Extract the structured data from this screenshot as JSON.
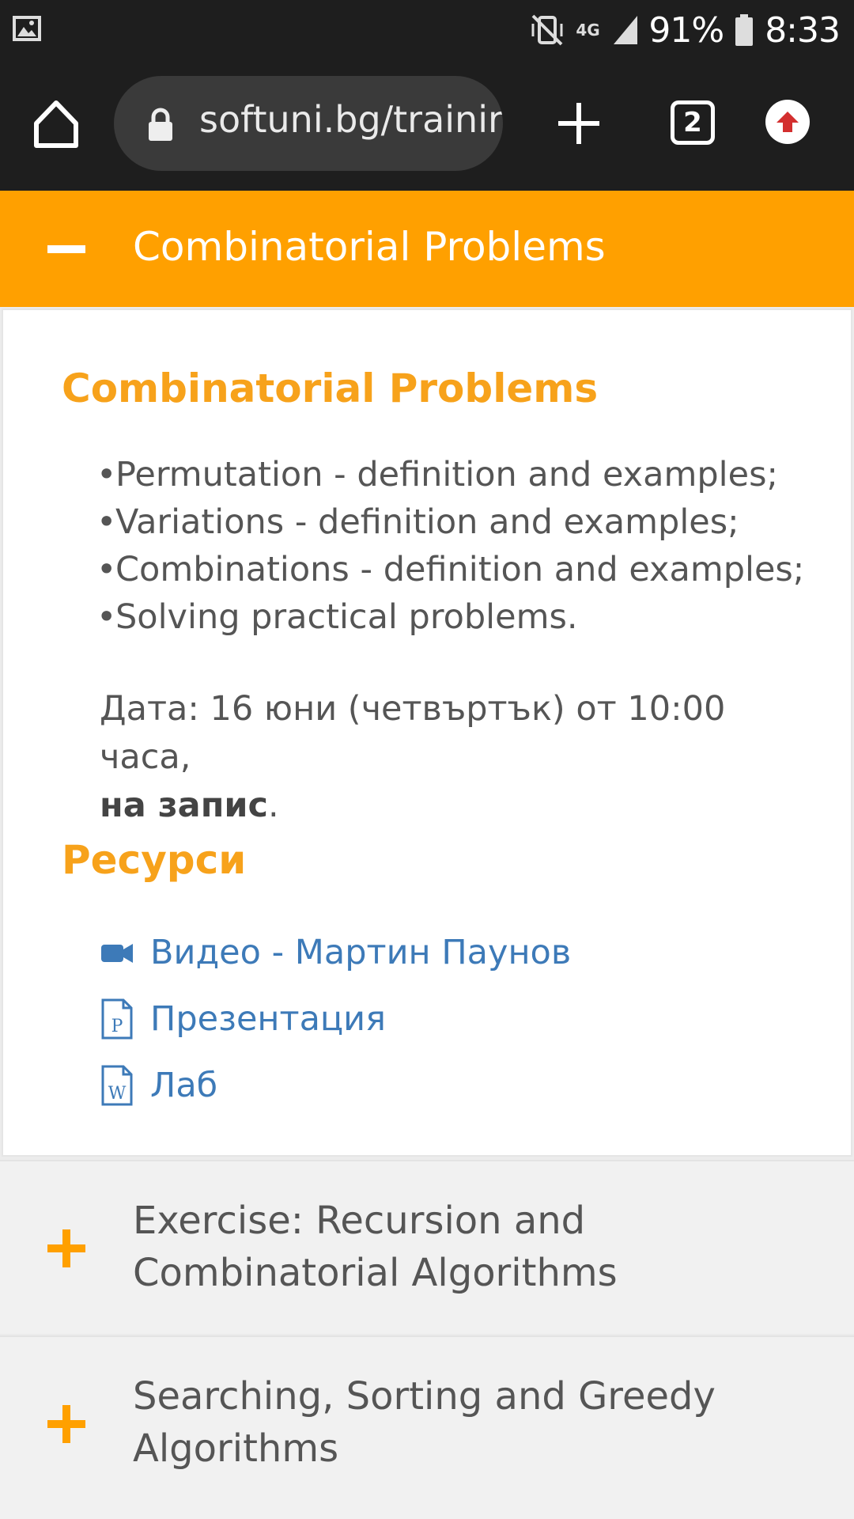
{
  "status_bar": {
    "battery": "91%",
    "time": "8:33",
    "network": "4G"
  },
  "browser": {
    "url": "softuni.bg/trainir",
    "tab_count": "2"
  },
  "accordion_open": {
    "title": "Combinatorial Problems"
  },
  "content": {
    "heading": "Combinatorial Problems",
    "bullets": [
      "Permutation - definition and examples;",
      "Variations - definition and examples;",
      "Combinations - definition and examples;",
      "Solving practical problems."
    ],
    "date_text": "Дата: 16 юни (четвъртък) от 10:00 часа,",
    "date_bold": "на запис",
    "date_end": ".",
    "resources_heading": "Ресурси",
    "resources": [
      {
        "label": "Видео - Мартин Паунов",
        "icon": "video-icon"
      },
      {
        "label": "Презентация",
        "icon": "powerpoint-file-icon"
      },
      {
        "label": "Лаб",
        "icon": "word-file-icon"
      }
    ]
  },
  "accordion_items": [
    {
      "title_line1": "Exercise: Recursion and",
      "title_line2": "Combinatorial Algorithms"
    },
    {
      "title_line1": "Searching, Sorting and Greedy",
      "title_line2": "Algorithms"
    }
  ],
  "colors": {
    "accent": "#ffa000",
    "heading": "#f7a21b",
    "link": "#3d7ab8",
    "toolbar": "#1e1e1e"
  }
}
